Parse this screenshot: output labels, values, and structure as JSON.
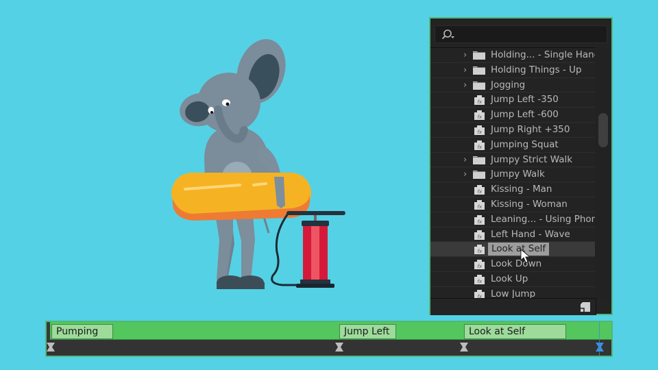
{
  "panel": {
    "search": {
      "placeholder": "",
      "value": "",
      "icon": "search-icon"
    },
    "items": [
      {
        "type": "folder",
        "label": "Holding... - Single Hand"
      },
      {
        "type": "folder",
        "label": "Holding Things - Up"
      },
      {
        "type": "folder",
        "label": "Jogging"
      },
      {
        "type": "preset",
        "label": "Jump Left -350"
      },
      {
        "type": "preset",
        "label": "Jump Left -600"
      },
      {
        "type": "preset",
        "label": "Jump Right +350"
      },
      {
        "type": "preset",
        "label": "Jumping Squat"
      },
      {
        "type": "folder",
        "label": "Jumpy Strict Walk"
      },
      {
        "type": "folder",
        "label": "Jumpy Walk"
      },
      {
        "type": "preset",
        "label": "Kissing - Man"
      },
      {
        "type": "preset",
        "label": "Kissing - Woman"
      },
      {
        "type": "preset",
        "label": "Leaning... - Using Phone"
      },
      {
        "type": "preset",
        "label": "Left Hand - Wave"
      },
      {
        "type": "preset",
        "label": "Look at Self",
        "selected": true
      },
      {
        "type": "preset",
        "label": "Look Down"
      },
      {
        "type": "preset",
        "label": "Look Up"
      },
      {
        "type": "preset",
        "label": "Low Jump"
      }
    ]
  },
  "timeline": {
    "clips": [
      {
        "label": "Pumping Air"
      },
      {
        "label": "Jump Left"
      },
      {
        "label": "Look at Self"
      }
    ]
  },
  "colors": {
    "background": "#55d1e5",
    "panel": "#232323",
    "track": "#54c65e",
    "clip": "#9ddb9b",
    "playhead": "#3a8ec9"
  }
}
